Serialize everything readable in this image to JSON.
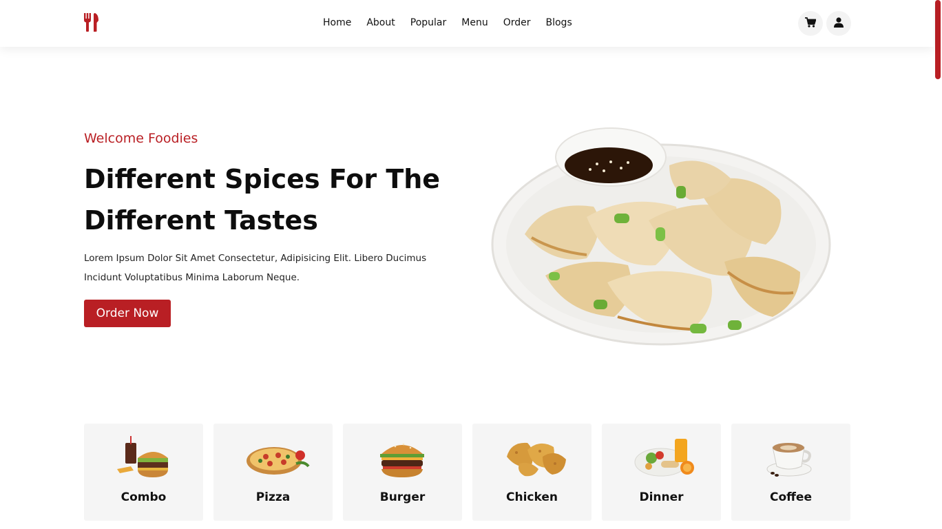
{
  "nav": {
    "items": [
      "Home",
      "About",
      "Popular",
      "Menu",
      "Order",
      "Blogs"
    ]
  },
  "icons": {
    "logo": "fork-knife-icon",
    "cart": "cart-icon",
    "user": "user-icon"
  },
  "hero": {
    "welcome": "Welcome Foodies",
    "title_line1": "Different Spices For The",
    "title_line2": "Different Tastes",
    "description": "Lorem Ipsum Dolor Sit Amet Consectetur, Adipisicing Elit. Libero Ducimus Incidunt Voluptatibus Minima Laborum Neque.",
    "button": "Order Now"
  },
  "categories": [
    {
      "label": "Combo"
    },
    {
      "label": "Pizza"
    },
    {
      "label": "Burger"
    },
    {
      "label": "Chicken"
    },
    {
      "label": "Dinner"
    },
    {
      "label": "Coffee"
    }
  ],
  "colors": {
    "accent": "#b91f24",
    "card_bg": "#f5f5f5",
    "text": "#111111"
  }
}
